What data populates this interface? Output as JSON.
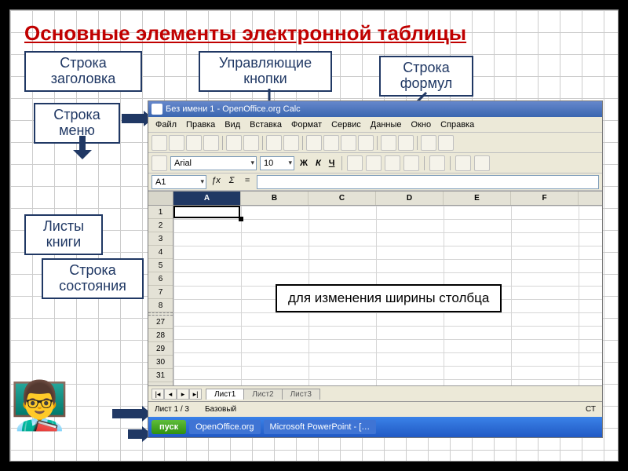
{
  "title": "Основные элементы электронной таблицы",
  "labels": {
    "titlebar": "Строка заголовка",
    "ctrl_buttons": "Управляющие кнопки",
    "formula_bar": "Строка формул",
    "menubar": "Строка меню",
    "sheets": "Листы книги",
    "statusbar": "Строка состояния"
  },
  "annotation": "для изменения ширины столбца",
  "teacher": "👨‍🏫",
  "calc": {
    "window_title": "Без имени 1 - OpenOffice.org Calc",
    "menu": [
      "Файл",
      "Правка",
      "Вид",
      "Вставка",
      "Формат",
      "Сервис",
      "Данные",
      "Окно",
      "Справка"
    ],
    "font_name": "Arial",
    "font_size": "10",
    "fmt": {
      "bold": "Ж",
      "italic": "К",
      "underline": "Ч"
    },
    "name_box": "A1",
    "fx": "ƒx",
    "sigma": "Σ",
    "eq": "=",
    "columns": [
      "A",
      "B",
      "C",
      "D",
      "E",
      "F"
    ],
    "rows_top": [
      "1",
      "2",
      "3",
      "4",
      "5",
      "6",
      "7",
      "8"
    ],
    "rows_bottom": [
      "27",
      "28",
      "29",
      "30",
      "31"
    ],
    "sheet_tabs": [
      "Лист1",
      "Лист2",
      "Лист3"
    ],
    "nav": [
      "|◂",
      "◂",
      "▸",
      "▸|"
    ],
    "status_left": "Лист 1 / 3",
    "status_mid": "Базовый",
    "status_std": "СТ",
    "start": "пуск",
    "task1": "OpenOffice.org",
    "task2": "Microsoft PowerPoint - […"
  }
}
